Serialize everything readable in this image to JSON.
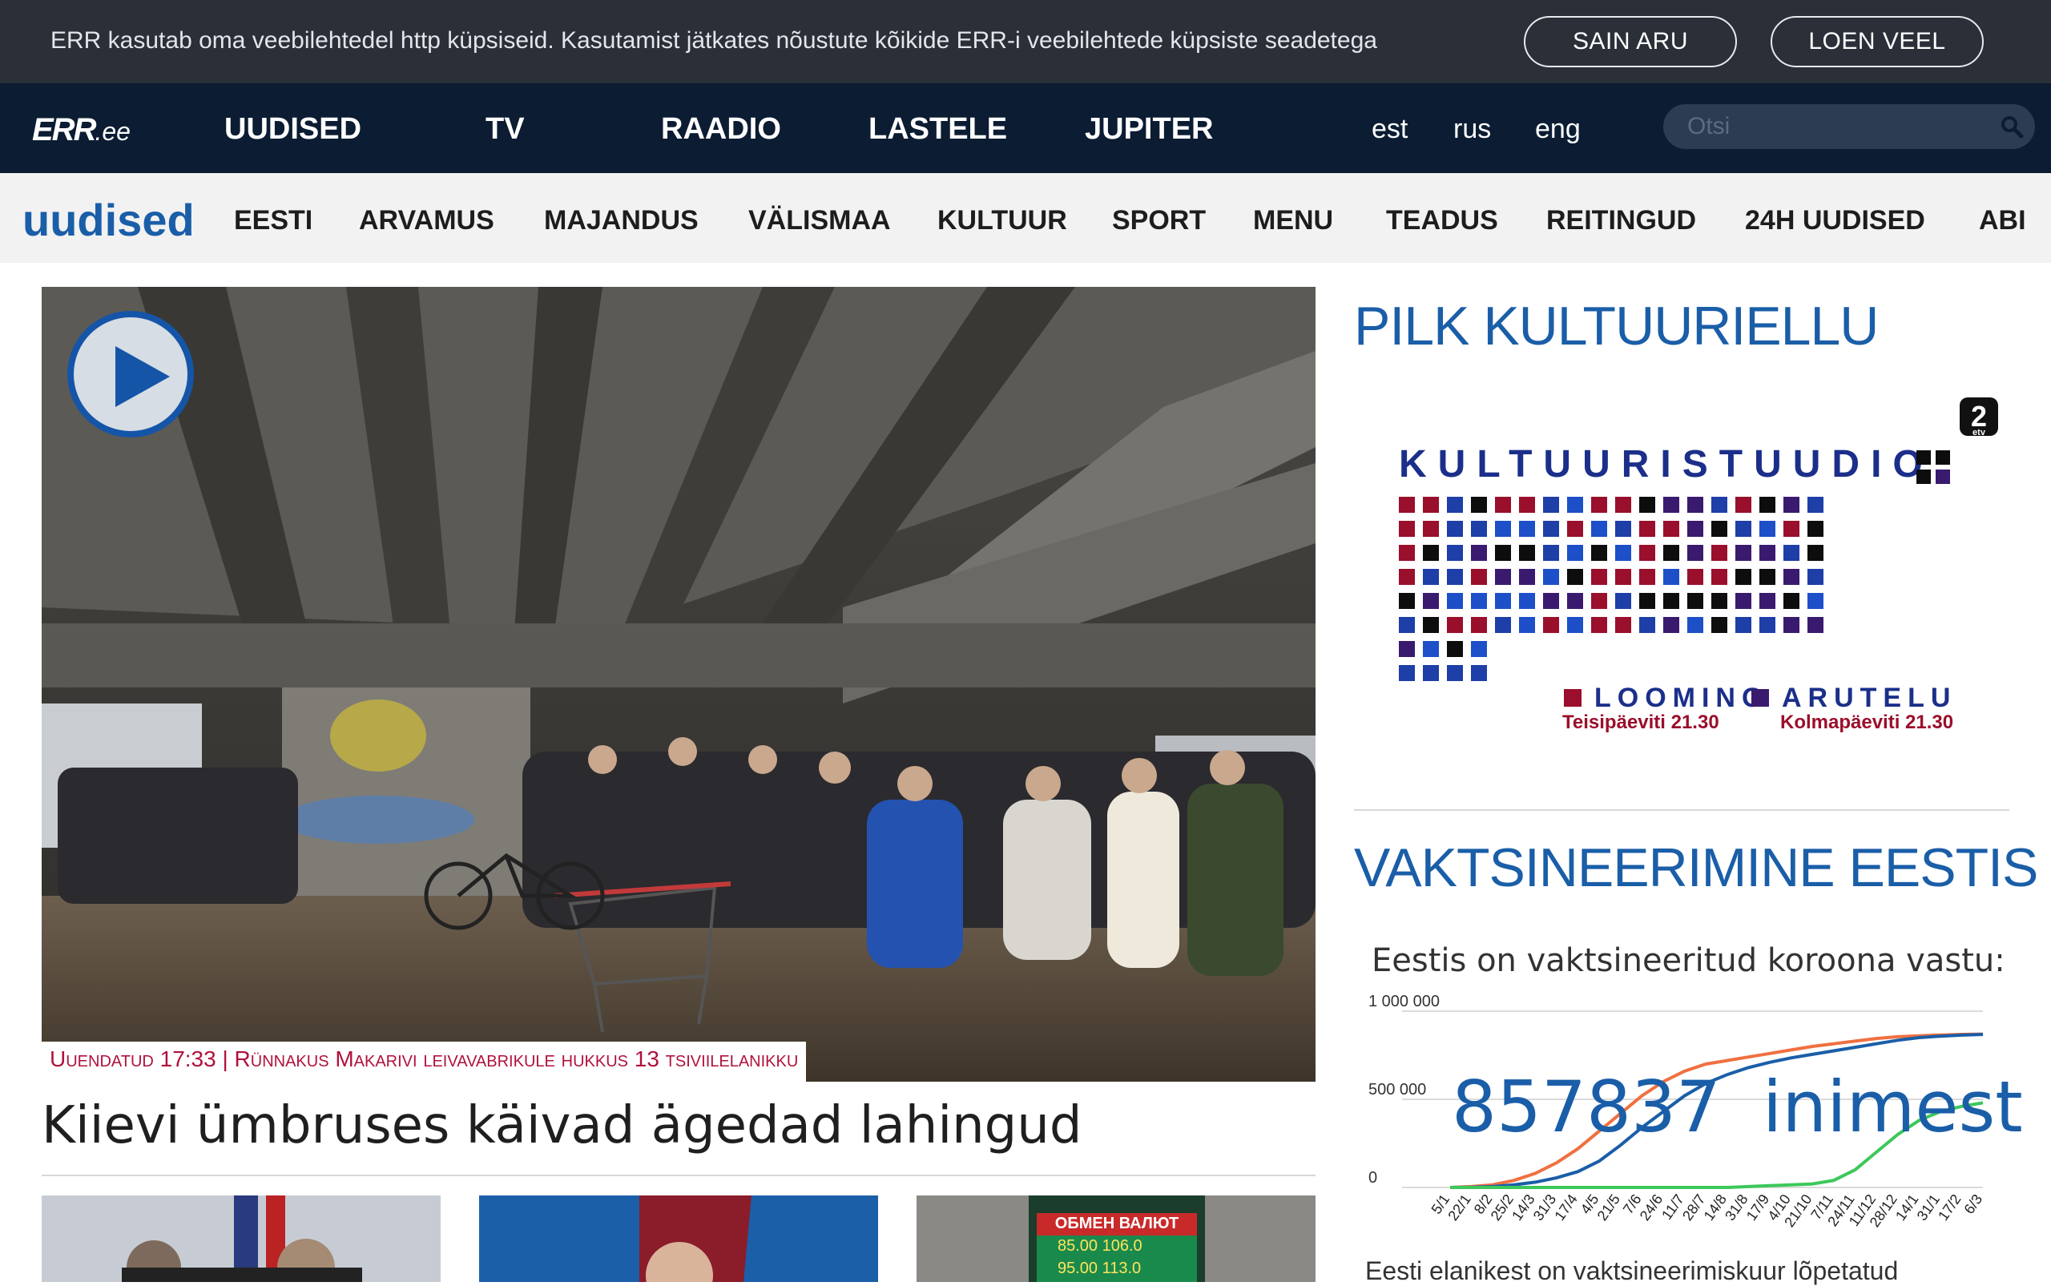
{
  "cookie_bar": {
    "text": "ERR kasutab oma veebilehtedel http küpsiseid. Kasutamist jätkates nõustute kõikide ERR-i veebilehtede küpsiste seadetega",
    "accept_label": "SAIN ARU",
    "more_label": "LOEN VEEL"
  },
  "main_nav": {
    "logo_main": "ERR",
    "logo_suffix": ".ee",
    "items": [
      "UUDISED",
      "TV",
      "RAADIO",
      "LASTELE",
      "JUPITER"
    ],
    "languages": [
      "est",
      "rus",
      "eng"
    ],
    "search_placeholder": "Otsi"
  },
  "sub_nav": {
    "section_logo": "uudised",
    "items": [
      "EESTI",
      "ARVAMUS",
      "MAJANDUS",
      "VÄLISMAA",
      "KULTUUR",
      "SPORT",
      "MENU",
      "TEADUS",
      "REITINGUD",
      "24H UUDISED",
      "ABI"
    ]
  },
  "hero": {
    "tag": "Uuendatud 17:33 | Rünnakus Makarivi leivavabrikule hukkus 13 tsiviilelanikku",
    "title": "Kiievi ümbruses käivad ägedad lahingud",
    "exchange_sign": "ОБМЕН ВАЛЮТ",
    "exchange_rate_1": "85.00 106.0",
    "exchange_rate_2": "95.00 113.0"
  },
  "sidebar": {
    "promo_title": "PILK KULTUURIELLU",
    "promo": {
      "channel_badge": "2",
      "channel_sub": "etv",
      "program": "KULTUURISTUUDIO",
      "legend_1": "LOOMING",
      "legend_1_time": "Teisipäeviti 21.30",
      "legend_2": "ARUTELU",
      "legend_2_time": "Kolmapäeviti 21.30",
      "palette": [
        "#1e3ea8",
        "#0d0d0d",
        "#9a0f2b",
        "#3a1a6e",
        "#1d4fc8"
      ]
    },
    "vacc_title": "VAKTSINEERIMINE EESTIS",
    "vacc_heading": "Eestis on vaktsineeritud koroona vastu:",
    "vacc_count": "857837",
    "vacc_unit": "inimest",
    "vacc_footer": "Eesti elanikest on vaktsineerimiskuur lõpetatud"
  },
  "chart_data": {
    "type": "line",
    "x": [
      "5/1",
      "22/1",
      "8/2",
      "25/2",
      "14/3",
      "31/3",
      "17/4",
      "4/5",
      "21/5",
      "7/6",
      "24/6",
      "11/7",
      "28/7",
      "14/8",
      "31/8",
      "17/9",
      "4/10",
      "21/10",
      "7/11",
      "24/11",
      "11/12",
      "28/12",
      "14/1",
      "31/1",
      "17/2",
      "6/3"
    ],
    "yticks": [
      "1 000 000",
      "500 000",
      "0"
    ],
    "ylim": [
      0,
      1000000
    ],
    "series": [
      {
        "color": "#f07040",
        "values": [
          0,
          5000,
          15000,
          40000,
          80000,
          140000,
          220000,
          320000,
          420000,
          520000,
          600000,
          660000,
          700000,
          720000,
          740000,
          760000,
          780000,
          800000,
          815000,
          830000,
          845000,
          855000,
          860000,
          865000,
          868000,
          870000
        ]
      },
      {
        "color": "#1a5ea8",
        "values": [
          0,
          1000,
          5000,
          15000,
          30000,
          55000,
          90000,
          150000,
          240000,
          340000,
          430000,
          520000,
          590000,
          640000,
          680000,
          710000,
          735000,
          755000,
          775000,
          795000,
          815000,
          835000,
          850000,
          858000,
          864000,
          868000
        ]
      },
      {
        "color": "#3cc85a",
        "values": [
          0,
          0,
          0,
          0,
          0,
          0,
          0,
          0,
          0,
          0,
          0,
          0,
          0,
          0,
          5000,
          10000,
          15000,
          20000,
          40000,
          100000,
          200000,
          300000,
          380000,
          430000,
          460000,
          480000
        ]
      }
    ]
  }
}
